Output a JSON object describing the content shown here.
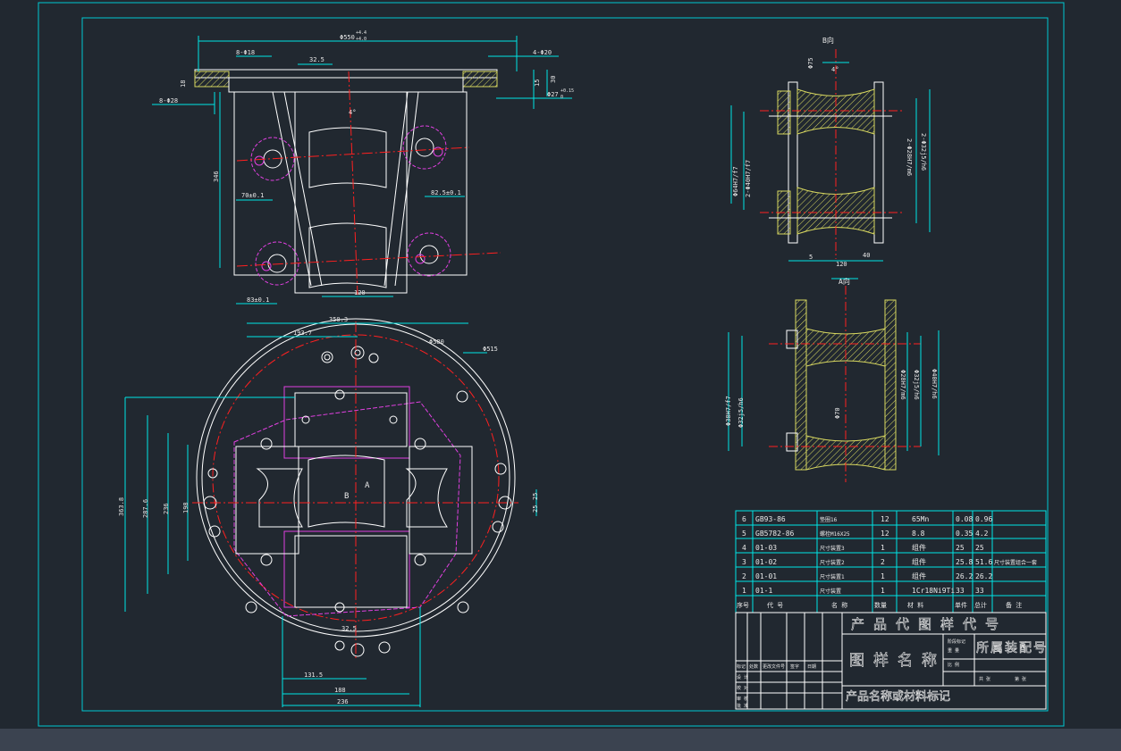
{
  "colors": {
    "bg": "#212830",
    "frame": "#00c8d2",
    "part": "#ffffff",
    "center": "#ff2020",
    "magenta": "#e040e0",
    "hatch": "#d8d860",
    "dim": "#00e6e6",
    "text": "#e8e8e8",
    "status": "#3b4350"
  },
  "top_view": {
    "d_overall": "Φ550",
    "tol_upper": "+4.4",
    "tol_lower": "+4.0",
    "holes_left": "8-Φ18",
    "dim_325": "32.5",
    "holes_right": "4-Φ20",
    "dim_18": "18",
    "holes_left2": "8-Φ28",
    "angle": "4°",
    "dim_15": "15",
    "dim_30": "30",
    "bore": "Φ27",
    "bore_tol": "+0.15",
    "bore_tol2": "0",
    "height": "346",
    "dim_70": "70±0.1",
    "dim_82": "82.5±0.1",
    "dim_83": "83±0.1",
    "dim_120": "120"
  },
  "plan_view": {
    "dim_3503": "350.3",
    "dim_1937": "193.7",
    "d580": "Φ580",
    "d515": "Φ515",
    "dim_3638": "363.8",
    "dim_2876": "287.6",
    "dim_236": "236",
    "dim_198": "198",
    "label_b": "B",
    "label_a": "A",
    "dim_25a": "25",
    "dim_25b": "25",
    "dim_325b": "32.5",
    "dim_1315": "131.5",
    "dim_188": "188",
    "dim_236b": "236"
  },
  "side_view": {
    "title": "B向",
    "d_left1": "Φ64H7/f7",
    "d_left2": "2-Φ40H7/f7",
    "d_right1": "2-Φ28H7/m6",
    "d_right2": "2-Φ32j5/h6",
    "d_top": "Φ75",
    "angle": "4°",
    "dim_120": "120",
    "dim_40": "40",
    "dim_5": "5"
  },
  "section_view": {
    "title": "A向",
    "d1": "Φ38H7/f7",
    "d2": "Φ32j5/h6",
    "d3": "Φ28H7/m6",
    "d4": "Φ32j5/h6",
    "d5": "Φ40H7/h6",
    "d6": "Φ70"
  },
  "bom": [
    {
      "no": "6",
      "code": "GB93-86",
      "name": "垫圈16",
      "qty": "12",
      "mat": "65Mn",
      "w1": "0.08",
      "w2": "0.96",
      "note": ""
    },
    {
      "no": "5",
      "code": "GB5782-86",
      "name": "螺栓M16X25",
      "qty": "12",
      "mat": "8.8",
      "w1": "0.35",
      "w2": "4.2",
      "note": ""
    },
    {
      "no": "4",
      "code": "01-03",
      "name": "尺寸装置3",
      "qty": "1",
      "mat": "组件",
      "w1": "25",
      "w2": "25",
      "note": ""
    },
    {
      "no": "3",
      "code": "01-02",
      "name": "尺寸装置2",
      "qty": "2",
      "mat": "组件",
      "w1": "25.8",
      "w2": "51.6",
      "note": "尺寸装置组合一套"
    },
    {
      "no": "2",
      "code": "01-01",
      "name": "尺寸装置1",
      "qty": "1",
      "mat": "组件",
      "w1": "26.2",
      "w2": "26.2",
      "note": ""
    },
    {
      "no": "1",
      "code": "01-1",
      "name": "尺寸装置",
      "qty": "1",
      "mat": "1Cr18Ni9Ti",
      "w1": "33",
      "w2": "33",
      "note": ""
    }
  ],
  "bom_header": {
    "no": "序号",
    "code": "代 号",
    "name": "名 称",
    "qty": "数量",
    "mat": "材 料",
    "w1": "单件",
    "w2": "总计",
    "note": "备 注"
  },
  "title_block": {
    "code": "产品代图样代号",
    "name": "图样名称",
    "assembly": "所属装配号",
    "material": "产品名称或材料标记",
    "row_labels": [
      "标记",
      "处数",
      "更改文件号",
      "签字",
      "日期"
    ],
    "left_labels": [
      "设 计",
      "校 对",
      "审 核",
      "批 准"
    ],
    "small1": "阶段标记",
    "small2": "重 量",
    "small3": "比 例",
    "small4": "共 张",
    "small5": "第 张"
  }
}
